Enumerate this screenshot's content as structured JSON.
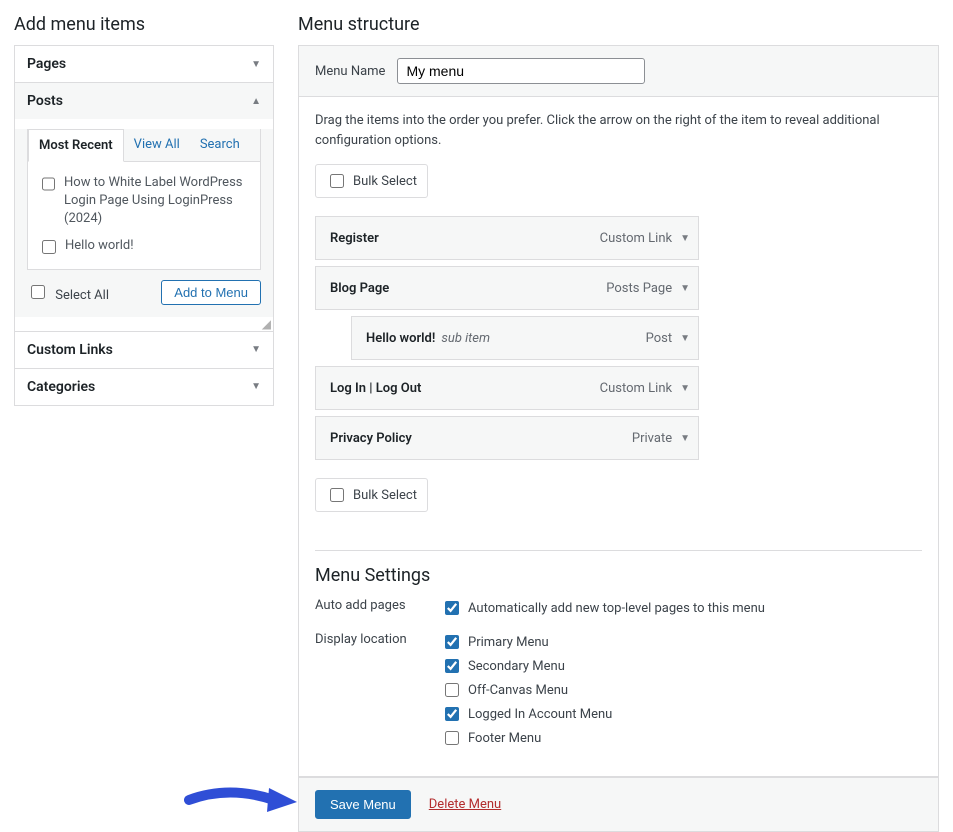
{
  "left": {
    "heading": "Add menu items",
    "sections": {
      "pages": {
        "label": "Pages"
      },
      "posts": {
        "label": "Posts",
        "tabs": {
          "recent": "Most Recent",
          "view_all": "View All",
          "search": "Search"
        },
        "items": {
          "0": "How to White Label WordPress Login Page Using LoginPress (2024)",
          "1": "Hello world!"
        },
        "select_all": "Select All",
        "add_btn": "Add to Menu"
      },
      "custom_links": {
        "label": "Custom Links"
      },
      "categories": {
        "label": "Categories"
      }
    }
  },
  "right": {
    "heading": "Menu structure",
    "name_label": "Menu Name",
    "name_value": "My menu",
    "help": "Drag the items into the order you prefer. Click the arrow on the right of the item to reveal additional configuration options.",
    "bulk": "Bulk Select",
    "items": {
      "0": {
        "title": "Register",
        "type": "Custom Link",
        "indent": false,
        "sub": ""
      },
      "1": {
        "title": "Blog Page",
        "type": "Posts Page",
        "indent": false,
        "sub": ""
      },
      "2": {
        "title": "Hello world!",
        "type": "Post",
        "indent": true,
        "sub": "sub item"
      },
      "3": {
        "title": "Log In | Log Out",
        "type": "Custom Link",
        "indent": false,
        "sub": ""
      },
      "4": {
        "title": "Privacy Policy",
        "type": "Private",
        "indent": false,
        "sub": ""
      }
    },
    "settings": {
      "heading": "Menu Settings",
      "auto_label": "Auto add pages",
      "auto_desc": "Automatically add new top-level pages to this menu",
      "display_label": "Display location",
      "locations": {
        "0": "Primary Menu",
        "1": "Secondary Menu",
        "2": "Off-Canvas Menu",
        "3": "Logged In Account Menu",
        "4": "Footer Menu"
      }
    },
    "save": "Save Menu",
    "delete": "Delete Menu"
  }
}
